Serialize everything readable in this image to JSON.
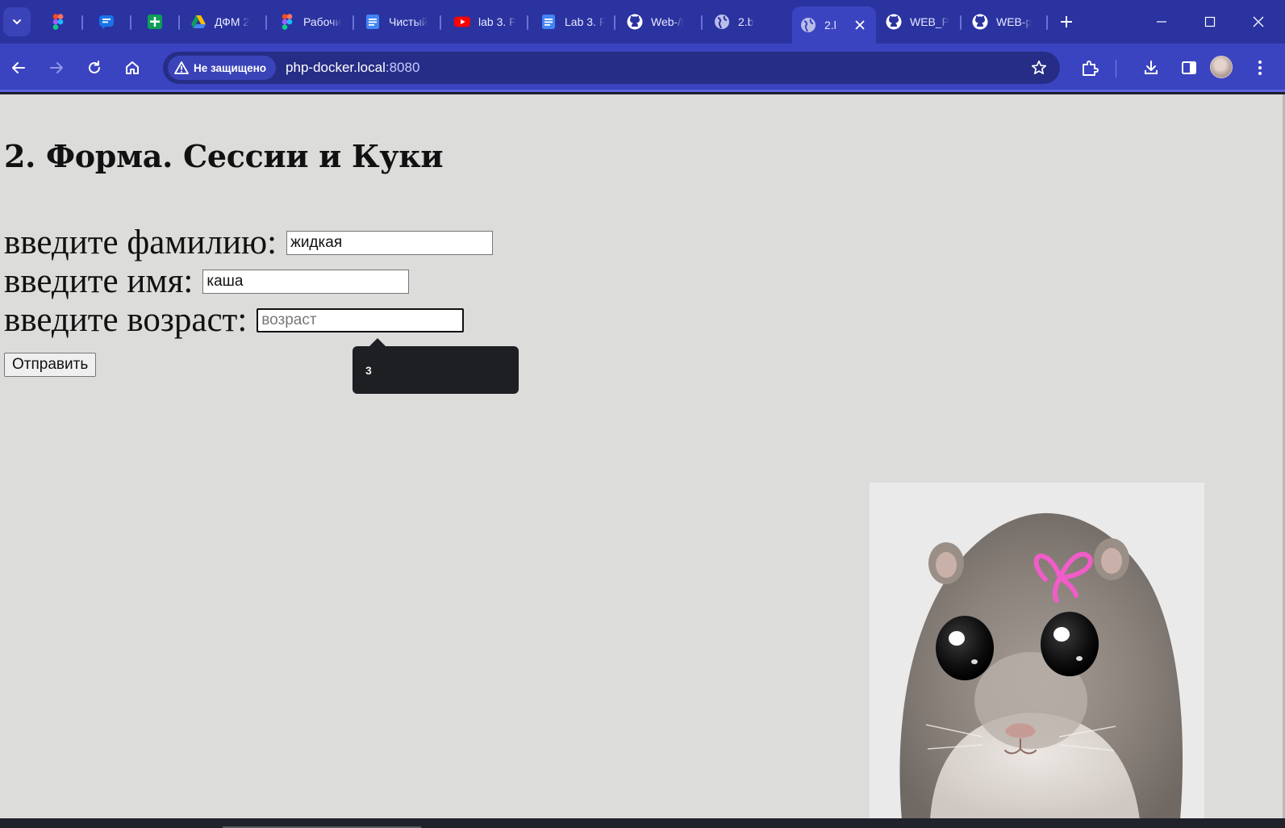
{
  "tabs": [
    {
      "label": "",
      "favicon": "figma-icon",
      "active": false
    },
    {
      "label": "",
      "favicon": "chat-icon",
      "active": false
    },
    {
      "label": "",
      "favicon": "sheets-icon",
      "active": false
    },
    {
      "label": "ДФМ 2",
      "favicon": "drive-icon",
      "active": false
    },
    {
      "label": "Рабочи",
      "favicon": "figma-icon",
      "active": false
    },
    {
      "label": "Чистый",
      "favicon": "docs-icon",
      "active": false
    },
    {
      "label": "lab 3. F",
      "favicon": "youtube-icon",
      "active": false
    },
    {
      "label": "Lab 3. F",
      "favicon": "docs-icon",
      "active": false
    },
    {
      "label": "Web-/l",
      "favicon": "github-icon",
      "active": false
    },
    {
      "label": "2.b",
      "favicon": "globe-icon",
      "active": false
    },
    {
      "label": "2.l",
      "favicon": "globe-icon",
      "active": true
    },
    {
      "label": "WEB_P",
      "favicon": "github-icon",
      "active": false
    },
    {
      "label": "WEB-p",
      "favicon": "github-icon",
      "active": false
    }
  ],
  "address_bar": {
    "security_label": "Не защищено",
    "host": "php-docker.local",
    "port": ":8080"
  },
  "colors": {
    "tabstrip": "#2b33a0",
    "toolbar": "#3b44c0",
    "page_background": "#dcdcda"
  },
  "page": {
    "title": "2. Форма. Сессии и Куки",
    "fields": {
      "surname_label": "введите фамилию:",
      "surname_value": "жидкая",
      "name_label": "введите имя:",
      "name_value": "каша",
      "age_label": "введите возраст:",
      "age_placeholder": "возраст",
      "age_value": ""
    },
    "submit_label": "Отправить",
    "tooltip_text": "3"
  }
}
